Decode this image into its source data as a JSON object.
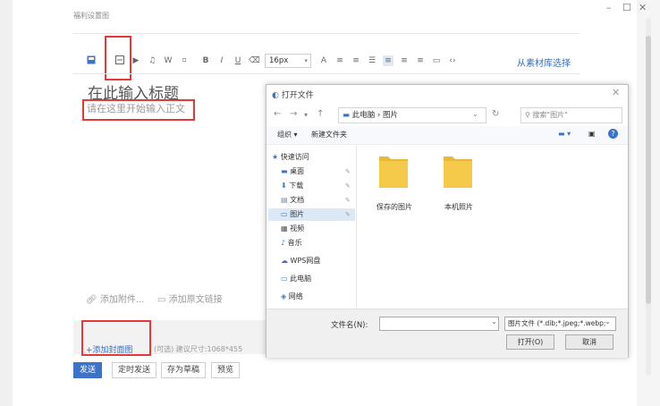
{
  "window": {
    "minimize": "–",
    "maximize": "☐",
    "close": "✕"
  },
  "editor": {
    "top_hint": "福利设置图",
    "toolbar": {
      "font_size": "16px",
      "bold": "B",
      "italic": "I",
      "underline": "U",
      "w": "W",
      "from_library": "从素材库选择"
    },
    "title_placeholder": "在此输入标题",
    "body_placeholder": "请在这里开始输入正文",
    "add_attachment": "添加附件...",
    "add_source_link": "添加原文链接",
    "add_cover": "+添加封面图",
    "cover_tip": "(可选) 建议尺寸:1068*455",
    "buttons": {
      "send": "发送",
      "schedule": "定时发送",
      "draft": "存为草稿",
      "preview": "预览"
    }
  },
  "dialog": {
    "title": "打开文件",
    "breadcrumb": "此电脑 › 图片",
    "search_placeholder": "搜索\"图片\"",
    "organize": "组织 ▾",
    "new_folder": "新建文件夹",
    "nav_items": [
      {
        "label": "快速访问",
        "icon": "star-icon"
      },
      {
        "label": "桌面",
        "icon": "desktop-icon"
      },
      {
        "label": "下载",
        "icon": "download-icon"
      },
      {
        "label": "文档",
        "icon": "document-icon"
      },
      {
        "label": "图片",
        "icon": "picture-icon"
      },
      {
        "label": "视频",
        "icon": "video-icon"
      },
      {
        "label": "音乐",
        "icon": "music-icon"
      },
      {
        "label": "WPS网盘",
        "icon": "cloud-icon"
      },
      {
        "label": "此电脑",
        "icon": "computer-icon"
      },
      {
        "label": "网络",
        "icon": "network-icon"
      }
    ],
    "folders": [
      "保存的图片",
      "本机照片"
    ],
    "filename_label": "文件名(N):",
    "filename_value": "",
    "filetype": "图片文件 (*.dib;*.jpeg;*.webp;",
    "open_button": "打开(O)",
    "cancel_button": "取消"
  },
  "colors": {
    "accent": "#3a73c9",
    "highlight_box": "#e53935",
    "folder": "#f5c94a"
  }
}
